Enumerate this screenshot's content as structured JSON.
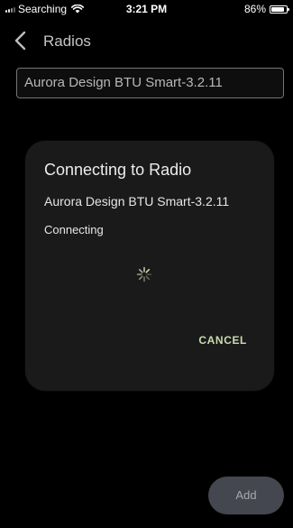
{
  "status_bar": {
    "carrier": "Searching",
    "time": "3:21 PM",
    "battery": "86%",
    "battery_level": 0.86,
    "icons": [
      "signal-icon",
      "wifi-icon",
      "battery-icon"
    ]
  },
  "nav": {
    "title": "Radios",
    "back_icon": "chevron-left-icon"
  },
  "radio_name_field": {
    "value": "Aurora Design BTU Smart-3.2.11"
  },
  "dialog": {
    "title": "Connecting to Radio",
    "radio_name": "Aurora Design BTU Smart-3.2.11",
    "status": "Connecting",
    "spinner_icon": "loading-spinner-icon",
    "cancel_label": "CANCEL"
  },
  "add_button": {
    "label": "Add"
  },
  "colors": {
    "background": "#000000",
    "dialog_background": "#1a1a1a",
    "accent": "#c9dcb0",
    "spinner": "#c9dcb0",
    "add_button_bg": "#44474f"
  }
}
